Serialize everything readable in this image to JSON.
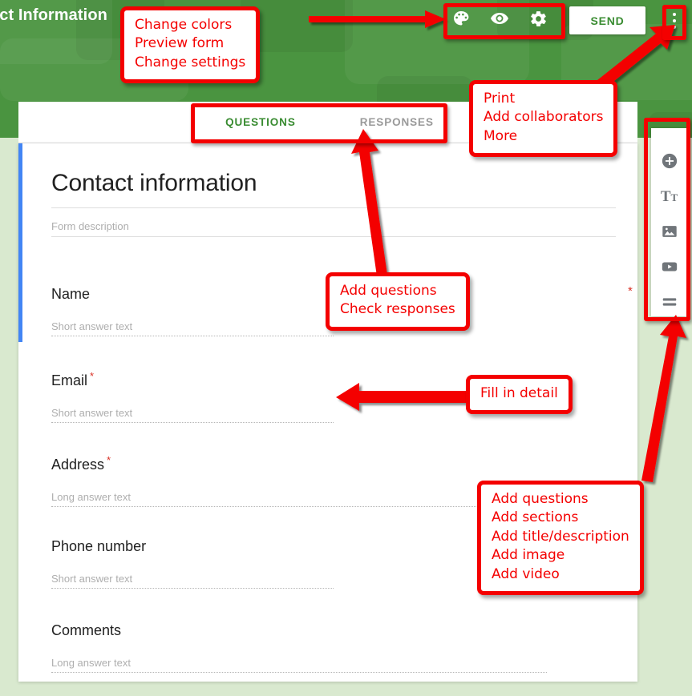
{
  "header": {
    "form_title_partial": "act Information",
    "icons": [
      {
        "name": "palette-icon",
        "label": "Change colors"
      },
      {
        "name": "eye-icon",
        "label": "Preview form"
      },
      {
        "name": "gear-icon",
        "label": "Change settings"
      }
    ],
    "send_label": "SEND",
    "kebab_label": "More options",
    "bg_color": "#4a9440"
  },
  "tabs": [
    {
      "label": "QUESTIONS",
      "active": true
    },
    {
      "label": "RESPONSES",
      "active": false
    }
  ],
  "form": {
    "title": "Contact information",
    "description_placeholder": "Form description",
    "required_legend": "*",
    "questions": [
      {
        "label": "Name",
        "required": false,
        "answer_placeholder": "Short answer text",
        "type": "short"
      },
      {
        "label": "Email",
        "required": true,
        "answer_placeholder": "Short answer text",
        "type": "short"
      },
      {
        "label": "Address",
        "required": true,
        "answer_placeholder": "Long answer text",
        "type": "long"
      },
      {
        "label": "Phone number",
        "required": false,
        "answer_placeholder": "Short answer text",
        "type": "short"
      },
      {
        "label": "Comments",
        "required": false,
        "answer_placeholder": "Long answer text",
        "type": "long"
      }
    ]
  },
  "side_toolbar": [
    {
      "name": "add-question-icon",
      "label": "Add question"
    },
    {
      "name": "add-title-icon",
      "label": "Add title and description"
    },
    {
      "name": "add-image-icon",
      "label": "Add image"
    },
    {
      "name": "add-video-icon",
      "label": "Add video"
    },
    {
      "name": "add-section-icon",
      "label": "Add section"
    }
  ],
  "annotations": {
    "accent_color": "#f40000",
    "callout_top_left": [
      "Change colors",
      "Preview form",
      "Change settings"
    ],
    "callout_top_right": [
      "Print",
      "Add collaborators",
      "More"
    ],
    "callout_middle": [
      "Add questions",
      "Check responses"
    ],
    "callout_fill": [
      "Fill in detail"
    ],
    "callout_bottom_right": [
      "Add questions",
      "Add sections",
      "Add title/description",
      "Add image",
      "Add video"
    ]
  }
}
